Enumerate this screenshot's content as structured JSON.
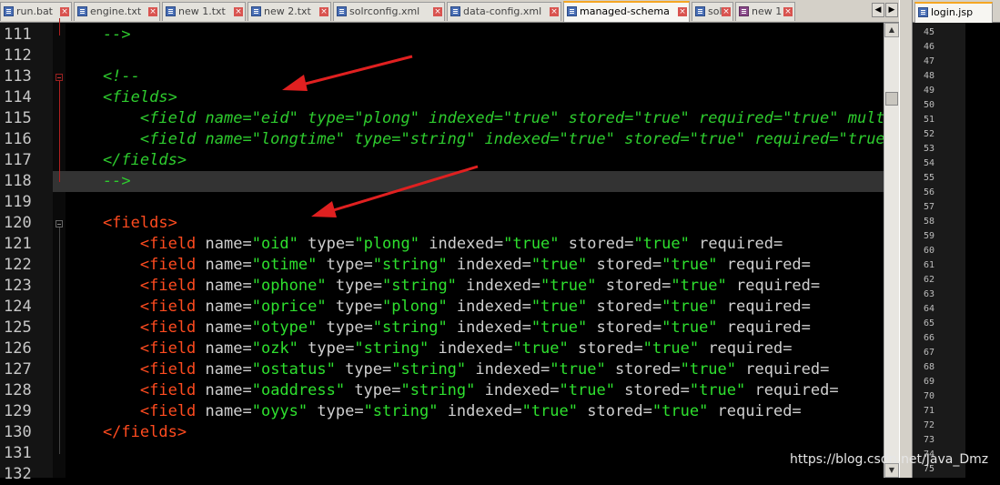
{
  "tabs": [
    {
      "label": "run.bat",
      "icon": "file-icon",
      "active": false
    },
    {
      "label": "engine.txt",
      "icon": "file-icon",
      "active": false
    },
    {
      "label": "new 1.txt",
      "icon": "file-icon",
      "active": false
    },
    {
      "label": "new 2.txt",
      "icon": "file-icon",
      "active": false
    },
    {
      "label": "solrconfig.xml",
      "icon": "file-icon",
      "active": false
    },
    {
      "label": "data-config.xml",
      "icon": "file-icon",
      "active": false
    },
    {
      "label": "managed-schema",
      "icon": "file-icon",
      "active": true
    },
    {
      "label": "solr",
      "icon": "file-icon",
      "active": false
    },
    {
      "label": "new 1",
      "icon": "file-purple-icon",
      "active": false
    }
  ],
  "right_tab": {
    "label": "login.jsp"
  },
  "lines": [
    {
      "n": "111",
      "tokens": [
        [
          "c-com",
          "    -->"
        ]
      ]
    },
    {
      "n": "112",
      "tokens": []
    },
    {
      "n": "113",
      "tokens": [
        [
          "c-com",
          "    <!--"
        ]
      ]
    },
    {
      "n": "114",
      "tokens": [
        [
          "c-com",
          "    <fields>"
        ]
      ]
    },
    {
      "n": "115",
      "tokens": [
        [
          "c-com",
          "        <field name=\"eid\" type=\"plong\" indexed=\"true\" stored=\"true\" required=\"true\" multiValued=\"false\" />"
        ]
      ]
    },
    {
      "n": "116",
      "tokens": [
        [
          "c-com",
          "        <field name=\"longtime\" type=\"string\" indexed=\"true\" stored=\"true\" required=\"true\" />"
        ]
      ]
    },
    {
      "n": "117",
      "tokens": [
        [
          "c-com",
          "    </fields>"
        ]
      ]
    },
    {
      "n": "118",
      "tokens": [
        [
          "c-com",
          "    -->"
        ]
      ],
      "current": true
    },
    {
      "n": "119",
      "tokens": []
    },
    {
      "n": "120",
      "tokens": [
        [
          "c-tag",
          "    <fields>"
        ]
      ]
    },
    {
      "n": "121",
      "tokens": [
        [
          "c-tag",
          "        <field "
        ],
        [
          "c-att",
          "name="
        ],
        [
          "c-val",
          "\"oid\""
        ],
        [
          "c-att",
          " type="
        ],
        [
          "c-val",
          "\"plong\""
        ],
        [
          "c-att",
          " indexed="
        ],
        [
          "c-val",
          "\"true\""
        ],
        [
          "c-att",
          " stored="
        ],
        [
          "c-val",
          "\"true\""
        ],
        [
          "c-att",
          " required="
        ]
      ]
    },
    {
      "n": "122",
      "tokens": [
        [
          "c-tag",
          "        <field "
        ],
        [
          "c-att",
          "name="
        ],
        [
          "c-val",
          "\"otime\""
        ],
        [
          "c-att",
          " type="
        ],
        [
          "c-val",
          "\"string\""
        ],
        [
          "c-att",
          " indexed="
        ],
        [
          "c-val",
          "\"true\""
        ],
        [
          "c-att",
          " stored="
        ],
        [
          "c-val",
          "\"true\""
        ],
        [
          "c-att",
          " required="
        ]
      ]
    },
    {
      "n": "123",
      "tokens": [
        [
          "c-tag",
          "        <field "
        ],
        [
          "c-att",
          "name="
        ],
        [
          "c-val",
          "\"ophone\""
        ],
        [
          "c-att",
          " type="
        ],
        [
          "c-val",
          "\"string\""
        ],
        [
          "c-att",
          " indexed="
        ],
        [
          "c-val",
          "\"true\""
        ],
        [
          "c-att",
          " stored="
        ],
        [
          "c-val",
          "\"true\""
        ],
        [
          "c-att",
          " required="
        ]
      ]
    },
    {
      "n": "124",
      "tokens": [
        [
          "c-tag",
          "        <field "
        ],
        [
          "c-att",
          "name="
        ],
        [
          "c-val",
          "\"oprice\""
        ],
        [
          "c-att",
          " type="
        ],
        [
          "c-val",
          "\"plong\""
        ],
        [
          "c-att",
          " indexed="
        ],
        [
          "c-val",
          "\"true\""
        ],
        [
          "c-att",
          " stored="
        ],
        [
          "c-val",
          "\"true\""
        ],
        [
          "c-att",
          " required="
        ]
      ]
    },
    {
      "n": "125",
      "tokens": [
        [
          "c-tag",
          "        <field "
        ],
        [
          "c-att",
          "name="
        ],
        [
          "c-val",
          "\"otype\""
        ],
        [
          "c-att",
          " type="
        ],
        [
          "c-val",
          "\"string\""
        ],
        [
          "c-att",
          " indexed="
        ],
        [
          "c-val",
          "\"true\""
        ],
        [
          "c-att",
          " stored="
        ],
        [
          "c-val",
          "\"true\""
        ],
        [
          "c-att",
          " required="
        ]
      ]
    },
    {
      "n": "126",
      "tokens": [
        [
          "c-tag",
          "        <field "
        ],
        [
          "c-att",
          "name="
        ],
        [
          "c-val",
          "\"ozk\""
        ],
        [
          "c-att",
          " type="
        ],
        [
          "c-val",
          "\"string\""
        ],
        [
          "c-att",
          " indexed="
        ],
        [
          "c-val",
          "\"true\""
        ],
        [
          "c-att",
          " stored="
        ],
        [
          "c-val",
          "\"true\""
        ],
        [
          "c-att",
          " required="
        ]
      ]
    },
    {
      "n": "127",
      "tokens": [
        [
          "c-tag",
          "        <field "
        ],
        [
          "c-att",
          "name="
        ],
        [
          "c-val",
          "\"ostatus\""
        ],
        [
          "c-att",
          " type="
        ],
        [
          "c-val",
          "\"string\""
        ],
        [
          "c-att",
          " indexed="
        ],
        [
          "c-val",
          "\"true\""
        ],
        [
          "c-att",
          " stored="
        ],
        [
          "c-val",
          "\"true\""
        ],
        [
          "c-att",
          " required="
        ]
      ]
    },
    {
      "n": "128",
      "tokens": [
        [
          "c-tag",
          "        <field "
        ],
        [
          "c-att",
          "name="
        ],
        [
          "c-val",
          "\"oaddress\""
        ],
        [
          "c-att",
          " type="
        ],
        [
          "c-val",
          "\"string\""
        ],
        [
          "c-att",
          " indexed="
        ],
        [
          "c-val",
          "\"true\""
        ],
        [
          "c-att",
          " stored="
        ],
        [
          "c-val",
          "\"true\""
        ],
        [
          "c-att",
          " required="
        ]
      ]
    },
    {
      "n": "129",
      "tokens": [
        [
          "c-tag",
          "        <field "
        ],
        [
          "c-att",
          "name="
        ],
        [
          "c-val",
          "\"oyys\""
        ],
        [
          "c-att",
          " type="
        ],
        [
          "c-val",
          "\"string\""
        ],
        [
          "c-att",
          " indexed="
        ],
        [
          "c-val",
          "\"true\""
        ],
        [
          "c-att",
          " stored="
        ],
        [
          "c-val",
          "\"true\""
        ],
        [
          "c-att",
          " required="
        ]
      ]
    },
    {
      "n": "130",
      "tokens": [
        [
          "c-tag",
          "    </fields>"
        ]
      ]
    },
    {
      "n": "131",
      "tokens": []
    },
    {
      "n": "132",
      "tokens": []
    }
  ],
  "right_lines": [
    "45",
    "46",
    "47",
    "48",
    "49",
    "50",
    "51",
    "52",
    "53",
    "54",
    "55",
    "56",
    "57",
    "58",
    "59",
    "60",
    "61",
    "62",
    "63",
    "64",
    "65",
    "66",
    "67",
    "68",
    "69",
    "70",
    "71",
    "72",
    "73",
    "74",
    "75"
  ],
  "watermark": "https://blog.csdn.net/Java_Dmz",
  "colors": {
    "comment": "#2ecc2e",
    "tag": "#ff4b1f",
    "attr": "#cfcfcf",
    "value": "#2ee02e",
    "arrow": "#e02020"
  }
}
